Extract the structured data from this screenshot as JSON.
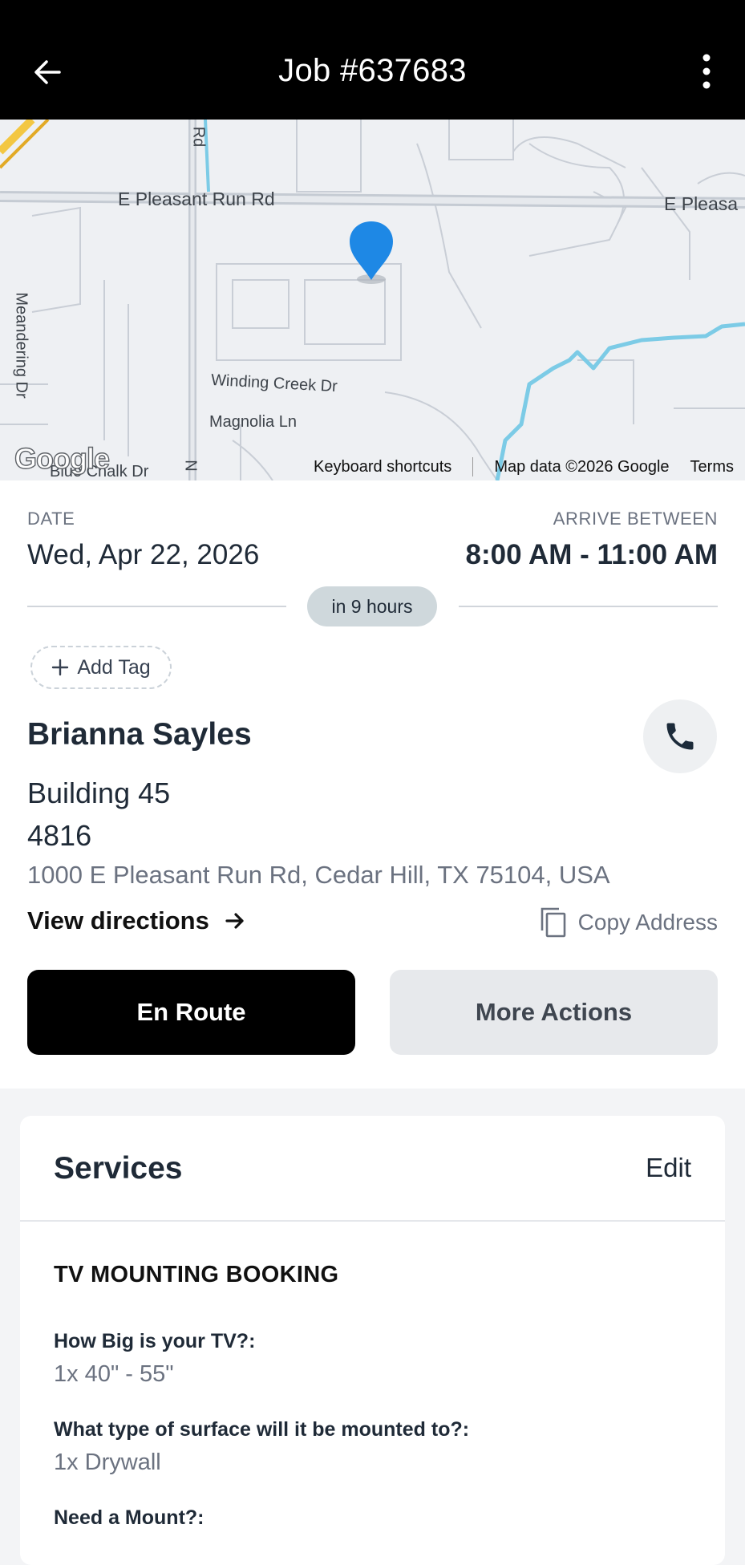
{
  "header": {
    "title": "Job #637683",
    "back_icon": "arrow-left-icon",
    "menu_icon": "more-vertical-icon"
  },
  "map": {
    "labels": {
      "pleasant_run": "E Pleasant Run Rd",
      "pleasant_run_cut": "E Pleasa",
      "winding_creek": "Winding Creek Dr",
      "magnolia": "Magnolia Ln",
      "meandering": "Meandering Dr",
      "blue_chalk": "Blue Chalk Dr",
      "rd": "Rd",
      "n": "N"
    },
    "logo": "Google",
    "attribution": {
      "shortcuts": "Keyboard shortcuts",
      "data": "Map data ©2026 Google",
      "terms": "Terms"
    },
    "marker_color": "#1e88e5"
  },
  "schedule": {
    "date_label": "DATE",
    "date_value": "Wed, Apr 22, 2026",
    "arrive_label": "ARRIVE BETWEEN",
    "arrive_value": "8:00 AM - 11:00 AM",
    "countdown": "in 9 hours"
  },
  "tags": {
    "add_label": "Add Tag"
  },
  "customer": {
    "name": "Brianna Sayles",
    "address_line1": "Building 45",
    "address_line2": "4816",
    "address_full": "1000 E Pleasant Run Rd, Cedar Hill, TX 75104, USA",
    "directions_label": "View directions",
    "copy_label": "Copy Address"
  },
  "actions": {
    "primary": "En Route",
    "secondary": "More Actions"
  },
  "services": {
    "title": "Services",
    "edit_label": "Edit",
    "booking_title": "TV MOUNTING BOOKING",
    "items": [
      {
        "question": "How Big is your TV?:",
        "answer": "1x 40\" - 55\""
      },
      {
        "question": "What type of surface will it be mounted to?:",
        "answer": "1x Drywall"
      },
      {
        "question": "Need a Mount?:",
        "answer": ""
      }
    ]
  },
  "colors": {
    "header_bg": "#000000",
    "primary_button": "#000000",
    "secondary_button": "#e7e9ec",
    "pill_bg": "#cfd8dc",
    "water": "#7ccbe6"
  }
}
